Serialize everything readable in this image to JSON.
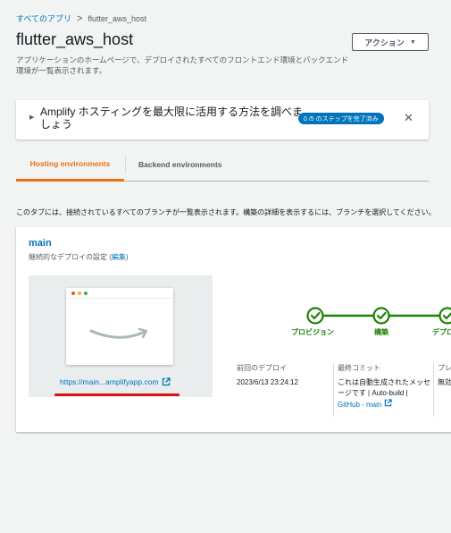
{
  "breadcrumb": {
    "all_apps": "すべてのアプリ",
    "separator": ">",
    "current": "flutter_aws_host"
  },
  "header": {
    "title": "flutter_aws_host",
    "description": "アプリケーションのホームページで、デプロイされたすべてのフロントエンド環境とバックエンド環境が一覧表示されます。",
    "action_button": "アクション"
  },
  "banner": {
    "title": "Amplify ホスティングを最大限に活用する方法を調べましょう",
    "progress_badge": "0 /5 のステップを完了済み",
    "close_icon": "close-icon"
  },
  "tabs": [
    {
      "label": "Hosting environments",
      "active": true
    },
    {
      "label": "Backend environments",
      "active": false
    }
  ],
  "tab_description": "このタブには、接続されているすべてのブランチが一覧表示されます。構築の詳細を表示するには、ブランチを選択してください。",
  "branch_card": {
    "branch_name": "main",
    "continuous_deploy_label": "継続的なデプロイの設定",
    "edit_link": "編集",
    "preview_url": "https://main...amplifyapp.com",
    "pipeline_steps": [
      "プロビジョン",
      "構築",
      "デプロイ"
    ],
    "last_deploy_label": "前回のデプロイ",
    "last_deploy_value": "2023/6/13 23:24:12",
    "last_commit_label": "最終コミット",
    "last_commit_text": "これは自動生成されたメッセージです | Auto-build |",
    "last_commit_link": "GitHub - main",
    "preview_col_label": "プレ",
    "preview_col_value": "無効"
  },
  "colors": {
    "link": "#0073bb",
    "accent": "#ec7211",
    "success": "#1d8102",
    "highlight": "#d91515"
  }
}
